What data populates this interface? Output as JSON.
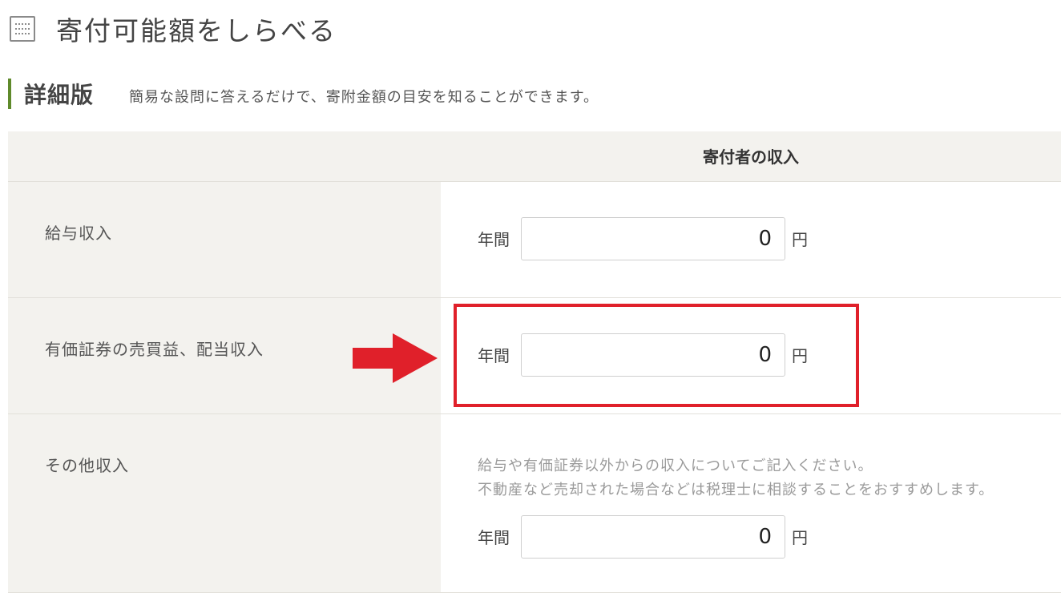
{
  "header": {
    "title": "寄付可能額をしらべる",
    "icon": "calculator-icon"
  },
  "section": {
    "title": "詳細版",
    "description": "簡易な設問に答えるだけで、寄附金額の目安を知ることができます。",
    "accent_color": "#5f8a2b"
  },
  "table": {
    "column_header": "寄付者の収入",
    "rows": [
      {
        "label": "給与収入",
        "prefix": "年間",
        "value": "0",
        "unit": "円"
      },
      {
        "label": "有価証券の売買益、配当収入",
        "prefix": "年間",
        "value": "0",
        "unit": "円"
      },
      {
        "label": "その他収入",
        "note_line1": "給与や有価証券以外からの収入についてご記入ください。",
        "note_line2": "不動産など売却された場合などは税理士に相談することをおすすめします。",
        "prefix": "年間",
        "value": "0",
        "unit": "円"
      }
    ]
  },
  "annotation": {
    "highlight_color": "#e0202a",
    "arrow_icon": "right-arrow-icon"
  }
}
